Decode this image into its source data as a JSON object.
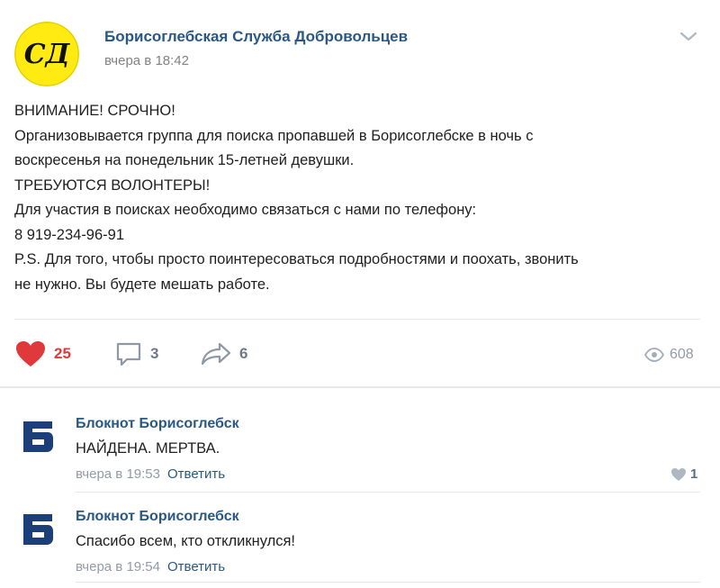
{
  "post": {
    "author": "Борисоглебская Служба Добровольцев",
    "avatar_text": "СД",
    "time": "вчера в 18:42",
    "text_lines": [
      "ВНИМАНИЕ! СРОЧНО!",
      "Организовывается группа для поиска пропавшей в Борисоглебске в ночь с",
      "воскресенья на понедельник 15-летней девушки.",
      "ТРЕБУЮТСЯ ВОЛОНТЕРЫ!",
      "Для участия в поисках необходимо связаться с нами по телефону:",
      "8 919-234-96-91",
      "P.S. Для того, чтобы просто поинтересоваться подробностями и поохать, звонить",
      "не нужно. Вы будете мешать работе."
    ],
    "likes": "25",
    "comments": "3",
    "shares": "6",
    "views": "608"
  },
  "icons": {
    "like": "heart-icon",
    "comment": "comment-icon",
    "share": "share-icon",
    "views": "eye-icon",
    "menu": "chevron-down-icon"
  },
  "colors": {
    "link": "#2a5885",
    "like_active": "#e0393b",
    "avatar_bg": "#ffeb12",
    "logo_blue": "#1c3f7a"
  },
  "comments": [
    {
      "author": "Блокнот Борисоглебск",
      "avatar_letter": "Б",
      "text": "НАЙДЕНА. МЕРТВА.",
      "time": "вчера в 19:53",
      "reply": "Ответить",
      "likes": "1"
    },
    {
      "author": "Блокнот Борисоглебск",
      "avatar_letter": "Б",
      "text": "Спасибо всем, кто откликнулся!",
      "time": "вчера в 19:54",
      "reply": "Ответить"
    }
  ]
}
